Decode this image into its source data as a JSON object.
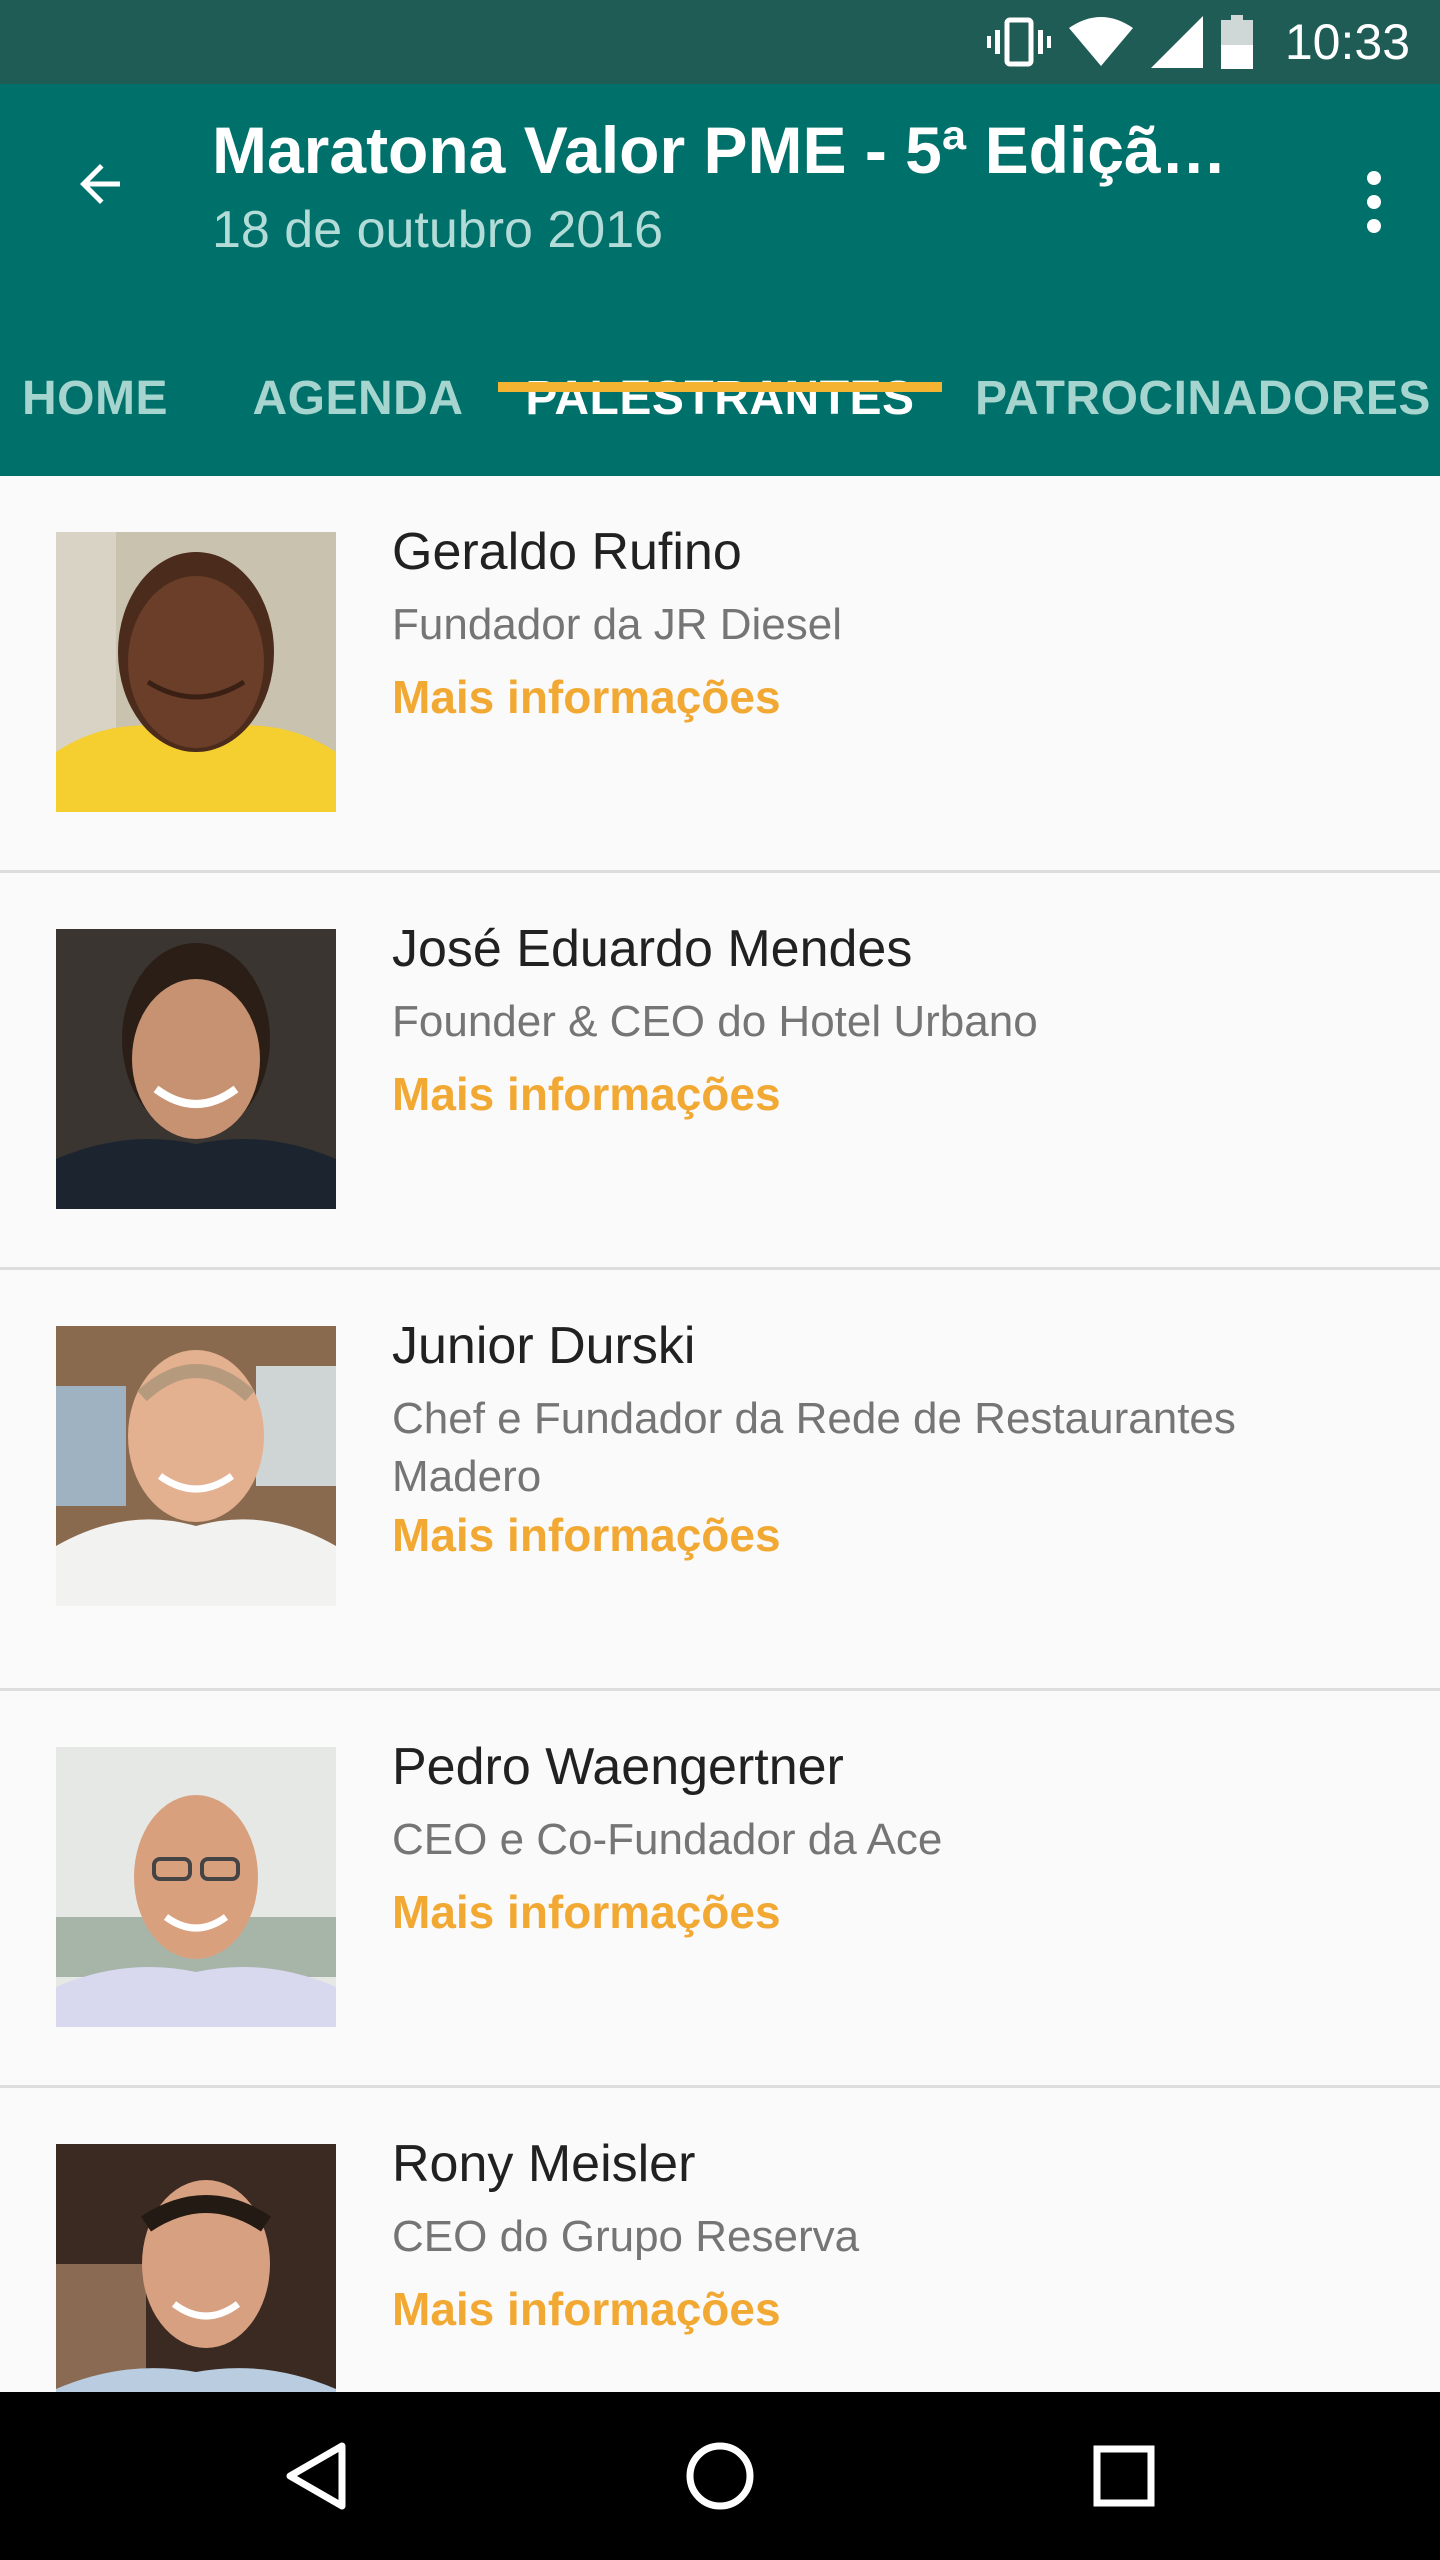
{
  "status_bar": {
    "time": "10:33",
    "icons": [
      "vibrate-icon",
      "wifi-icon",
      "signal-icon",
      "battery-icon"
    ]
  },
  "app_bar": {
    "title": "Maratona Valor PME - 5ª Edição...",
    "subtitle": "18 de outubro 2016",
    "tabs": [
      "HOME",
      "AGENDA",
      "PALESTRANTES",
      "PATROCINADORES"
    ],
    "active_tab": "PALESTRANTES"
  },
  "speakers": [
    {
      "name": "Geraldo Rufino",
      "role": "Fundador da JR Diesel",
      "link": "Mais informações"
    },
    {
      "name": "José Eduardo Mendes",
      "role": "Founder & CEO do Hotel Urbano",
      "link": "Mais informações"
    },
    {
      "name": "Junior Durski",
      "role": "Chef e Fundador da Rede de Restaurantes Madero",
      "link": "Mais informações"
    },
    {
      "name": "Pedro Waengertner",
      "role": "CEO e Co-Fundador da Ace",
      "link": "Mais informações"
    },
    {
      "name": "Rony Meisler",
      "role": "CEO do Grupo Reserva",
      "link": "Mais informações"
    }
  ],
  "colors": {
    "status_bar": "#1f5c56",
    "app_bar": "#00706a",
    "accent": "#f5b332",
    "link": "#f2a934"
  }
}
